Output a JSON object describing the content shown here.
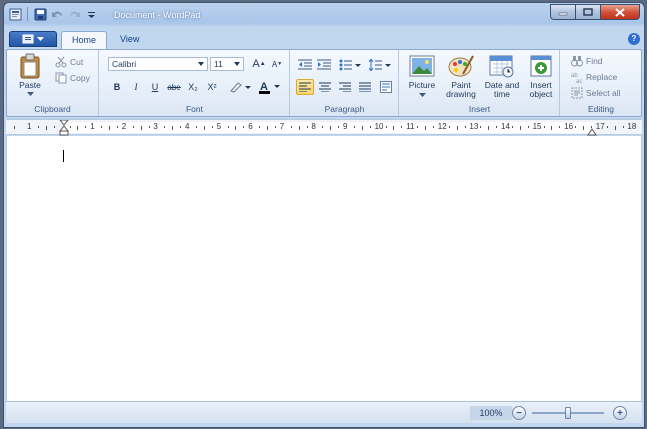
{
  "window": {
    "title": "Document - WordPad"
  },
  "qat": {
    "items": [
      "save-icon",
      "undo-icon",
      "redo-icon",
      "customize-icon"
    ]
  },
  "tabs": [
    {
      "label": "Home",
      "active": true
    },
    {
      "label": "View",
      "active": false
    }
  ],
  "ribbon": {
    "clipboard": {
      "label": "Clipboard",
      "paste": "Paste",
      "cut": "Cut",
      "copy": "Copy"
    },
    "font": {
      "label": "Font",
      "family": "Calibri",
      "size": "11",
      "bold": "B",
      "italic": "I",
      "underline": "U",
      "strike": "abe",
      "subscript": "X₂",
      "superscript": "X²",
      "grow": "A",
      "shrink": "A"
    },
    "paragraph": {
      "label": "Paragraph",
      "active_alignment": "left"
    },
    "insert": {
      "label": "Insert",
      "picture": "Picture",
      "paint_drawing": [
        "Paint",
        "drawing"
      ],
      "date_time": [
        "Date and",
        "time"
      ],
      "insert_object": [
        "Insert",
        "object"
      ]
    },
    "editing": {
      "label": "Editing",
      "find": "Find",
      "replace": "Replace",
      "select_all": "Select all"
    }
  },
  "ruler": {
    "numbers": [
      "1",
      "2",
      "1",
      "2",
      "3",
      "4",
      "5",
      "6",
      "7",
      "8",
      "9",
      "10",
      "11",
      "12",
      "13",
      "14",
      "15",
      "16",
      "17",
      "18"
    ]
  },
  "status": {
    "zoom": "100%",
    "zoom_out": "−",
    "zoom_in": "+",
    "zoom_level": 0.5
  },
  "colors": {
    "accent": "#2256a8",
    "ribbon": "#e4edf8",
    "highlight": "#fbd36b"
  }
}
